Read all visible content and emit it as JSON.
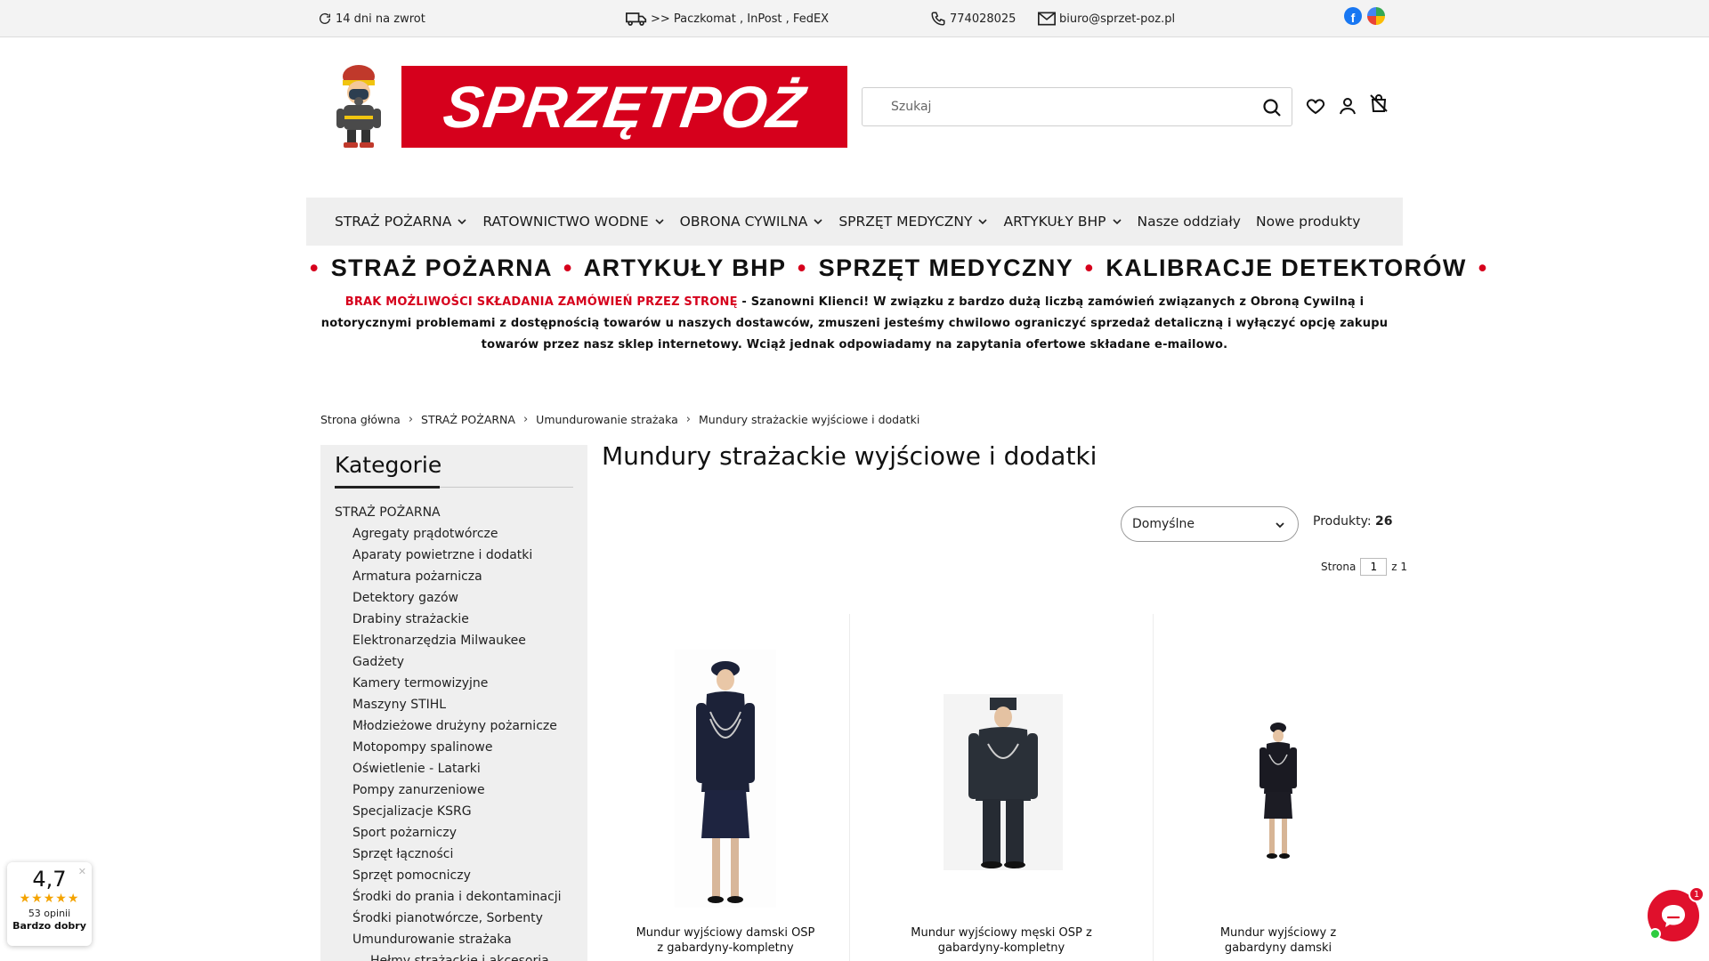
{
  "topbar": {
    "returns": "14 dni na zwrot",
    "shipping": ">> Paczkomat , InPost , FedEX",
    "phone": "774028025",
    "email": "biuro@sprzet-poz.pl"
  },
  "header": {
    "logo_text": "SPRZĘTPOŻ",
    "search_placeholder": "Szukaj"
  },
  "nav": {
    "items": [
      {
        "label": "STRAŻ POŻARNA",
        "dropdown": true
      },
      {
        "label": "RATOWNICTWO WODNE",
        "dropdown": true
      },
      {
        "label": "OBRONA CYWILNA",
        "dropdown": true
      },
      {
        "label": "SPRZĘT MEDYCZNY",
        "dropdown": true
      },
      {
        "label": "ARTYKUŁY BHP",
        "dropdown": true
      },
      {
        "label": "Nasze oddziały",
        "dropdown": false
      },
      {
        "label": "Nowe produkty",
        "dropdown": false
      }
    ]
  },
  "banner": {
    "items": [
      "STRAŻ POŻARNA",
      "ARTYKUŁY BHP",
      "SPRZĘT MEDYCZNY",
      "KALIBRACJE DETEKTORÓW"
    ],
    "dot": "•"
  },
  "notice": {
    "highlight": "BRAK MOŻLIWOŚCI SKŁADANIA ZAMÓWIEŃ PRZEZ STRONĘ",
    "body": " - Szanowni Klienci! W związku z bardzo dużą liczbą zamówień związanych z Obroną Cywilną i notorycznymi problemami z dostępnością towarów u naszych dostawców, zmuszeni jesteśmy chwilowo ograniczyć sprzedaż detaliczną i wyłączyć opcję zakupu towarów przez nasz sklep internetowy. Wciąż jednak odpowiadamy na zapytania ofertowe składane e-mailowo."
  },
  "breadcrumb": [
    "Strona główna",
    "STRAŻ POŻARNA",
    "Umundurowanie strażaka",
    "Mundury strażackie wyjściowe i dodatki"
  ],
  "sidebar": {
    "title": "Kategorie",
    "categories": [
      {
        "label": "STRAŻ POŻARNA",
        "level": 0
      },
      {
        "label": "Agregaty prądotwórcze",
        "level": 1
      },
      {
        "label": "Aparaty powietrzne i dodatki",
        "level": 1
      },
      {
        "label": "Armatura pożarnicza",
        "level": 1
      },
      {
        "label": "Detektory gazów",
        "level": 1
      },
      {
        "label": "Drabiny strażackie",
        "level": 1
      },
      {
        "label": "Elektronarzędzia Milwaukee",
        "level": 1
      },
      {
        "label": "Gadżety",
        "level": 1
      },
      {
        "label": "Kamery termowizyjne",
        "level": 1
      },
      {
        "label": "Maszyny STIHL",
        "level": 1
      },
      {
        "label": "Młodzieżowe drużyny pożarnicze",
        "level": 1
      },
      {
        "label": "Motopompy spalinowe",
        "level": 1
      },
      {
        "label": "Oświetlenie - Latarki",
        "level": 1
      },
      {
        "label": "Pompy zanurzeniowe",
        "level": 1
      },
      {
        "label": "Specjalizacje KSRG",
        "level": 1
      },
      {
        "label": "Sport pożarniczy",
        "level": 1
      },
      {
        "label": "Sprzęt łączności",
        "level": 1
      },
      {
        "label": "Sprzęt pomocniczy",
        "level": 1
      },
      {
        "label": "Środki do prania i dekontaminacji",
        "level": 1
      },
      {
        "label": "Środki pianotwórcze, Sorbenty",
        "level": 1
      },
      {
        "label": "Umundurowanie strażaka",
        "level": 1
      },
      {
        "label": "Hełmy strażackie i akcesoria",
        "level": 2
      }
    ]
  },
  "main": {
    "title": "Mundury strażackie wyjściowe i dodatki",
    "sort_value": "Domyślne",
    "products_label": "Produkty:",
    "products_count": "26",
    "page_label": "Strona",
    "page_current": "1",
    "page_total": "z 1"
  },
  "products": [
    {
      "line1": "Mundur wyjściowy damski OSP",
      "line2": "z gabardyny-kompletny"
    },
    {
      "line1": "Mundur wyjściowy męski OSP z",
      "line2": "gabardyny-kompletny"
    },
    {
      "line1": "Mundur wyjściowy z",
      "line2": "gabardyny damski"
    }
  ],
  "rating": {
    "value": "4,7",
    "stars": "★★★★★",
    "count": "53 opinii",
    "label": "Bardzo dobry",
    "close": "✕"
  },
  "chat": {
    "badge": "1"
  },
  "colors": {
    "brand_red": "#d6001c",
    "nav_bg": "#efefef",
    "star": "#f4a300"
  }
}
